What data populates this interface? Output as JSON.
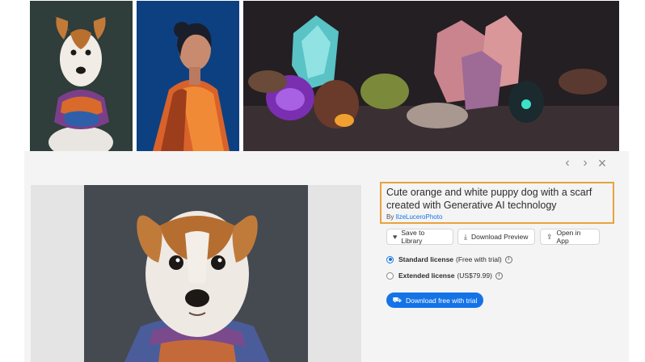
{
  "thumbnails": [
    {
      "id_label": "dog-with-scarf-thumbnail"
    },
    {
      "id_label": "woman-portrait-thumbnail"
    },
    {
      "id_label": "glowing-crystals-thumbnail"
    }
  ],
  "nav": {
    "prev_icon": "chevron-left-icon",
    "next_icon": "chevron-right-icon",
    "close_icon": "close-icon"
  },
  "asset": {
    "title": "Cute orange and white puppy dog with a scarf created with Generative AI technology",
    "by_prefix": "By",
    "author": "IlzeLuceroPhoto"
  },
  "actions": {
    "save": "Save to Library",
    "download_preview": "Download Preview",
    "open_in_app": "Open in App"
  },
  "licenses": {
    "standard_name": "Standard license",
    "standard_note": "(Free with trial)",
    "extended_name": "Extended license",
    "extended_note": "(US$79.99)"
  },
  "cta": {
    "label": "Download free with trial"
  },
  "colors": {
    "accent": "#1473e6",
    "highlight_border": "#e8a33d",
    "panel_bg": "#f4f4f4"
  }
}
